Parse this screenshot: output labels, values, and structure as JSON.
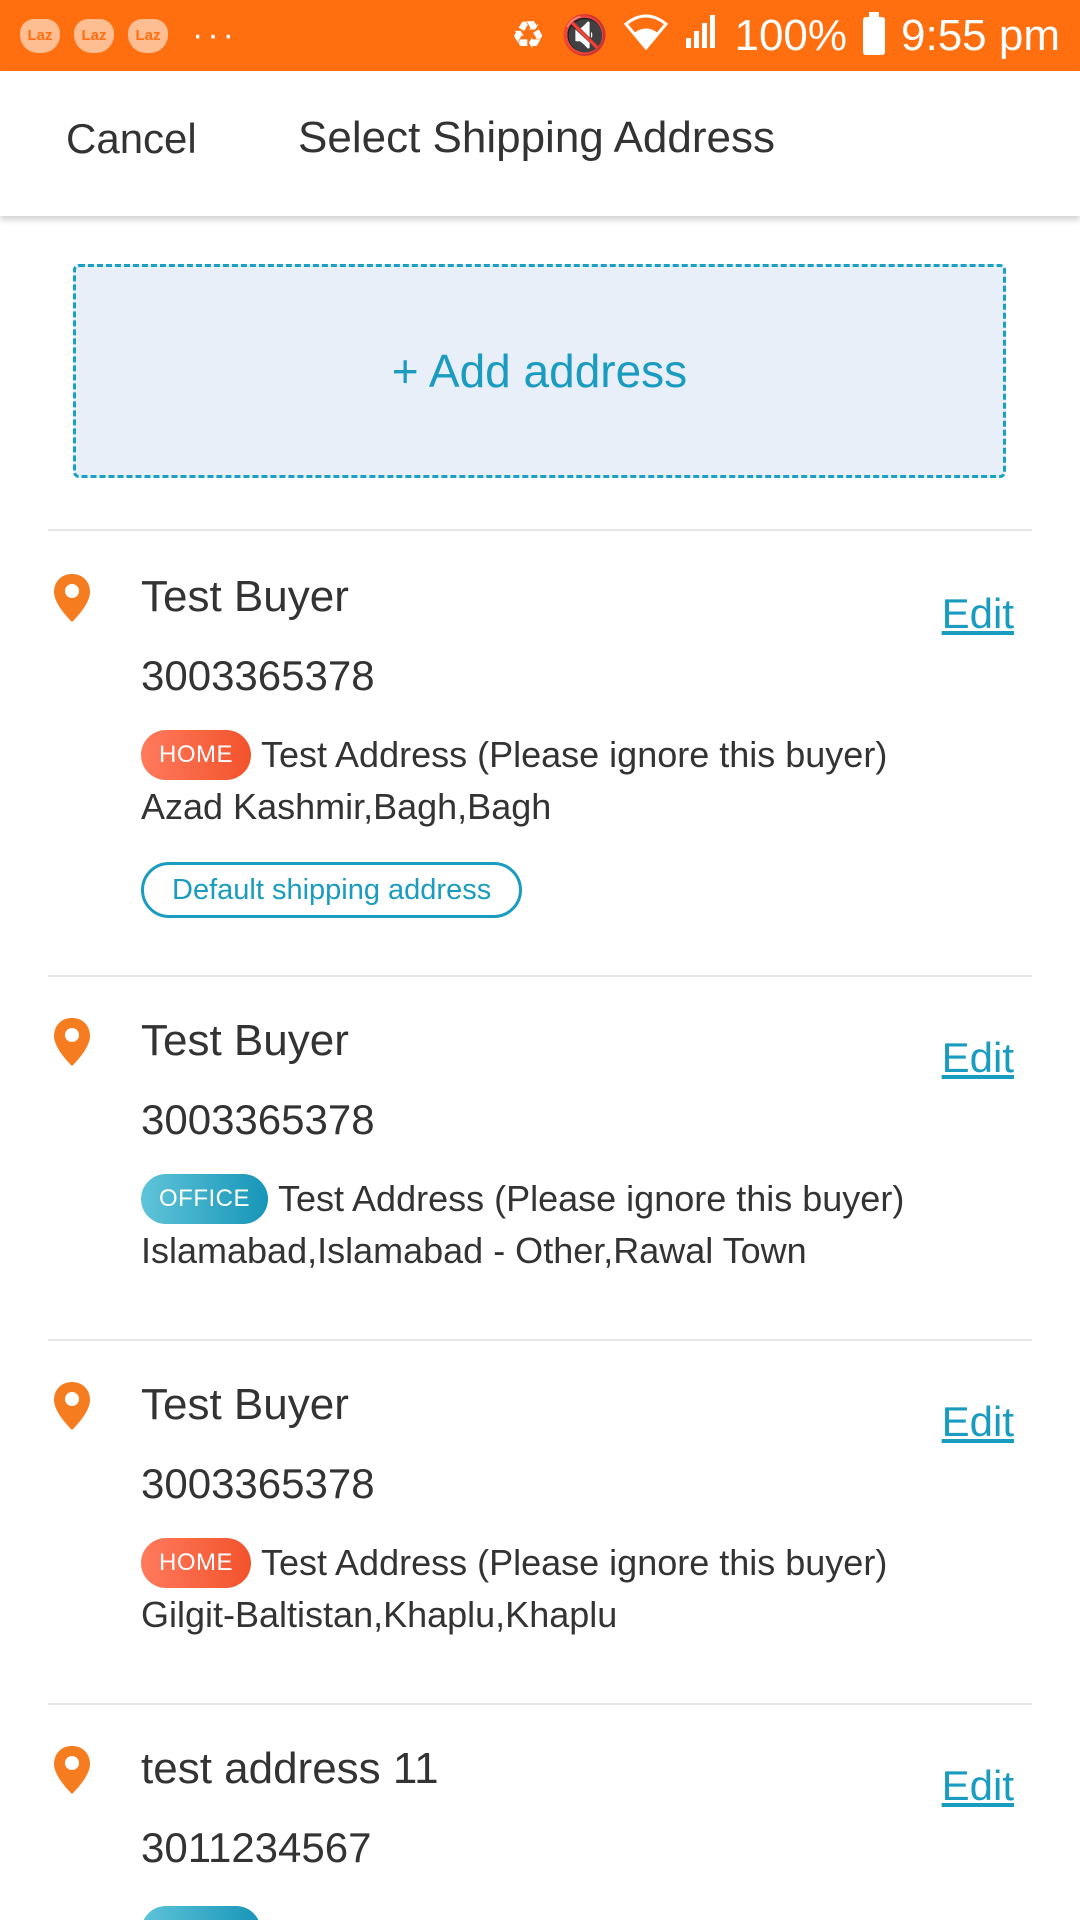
{
  "status_bar": {
    "app_icons": [
      "Laz",
      "Laz",
      "Laz"
    ],
    "more": "···",
    "battery_percent": "100%",
    "time": "9:55 pm",
    "background_color": "#ff6f0f"
  },
  "header": {
    "cancel_label": "Cancel",
    "title": "Select Shipping Address"
  },
  "add_address": {
    "label": "+ Add address"
  },
  "addresses": [
    {
      "name": "Test Buyer",
      "phone": "3003365378",
      "tag": "HOME",
      "line1": "Test Address (Please ignore this buyer)",
      "line2": "Azad Kashmir,Bagh,Bagh",
      "default_label": "Default shipping address",
      "edit_label": "Edit"
    },
    {
      "name": "Test Buyer",
      "phone": "3003365378",
      "tag": "OFFICE",
      "line1": "Test Address (Please ignore this buyer)",
      "line2": "Islamabad,Islamabad - Other,Rawal Town",
      "edit_label": "Edit"
    },
    {
      "name": "Test Buyer",
      "phone": "3003365378",
      "tag": "HOME",
      "line1": "Test Address (Please ignore this buyer)",
      "line2": "Gilgit-Baltistan,Khaplu,Khaplu",
      "edit_label": "Edit"
    },
    {
      "name": "test address 11",
      "phone": "3011234567",
      "edit_label": "Edit"
    }
  ],
  "colors": {
    "accent": "#1a9bc0",
    "pin": "#f57c1f",
    "home_tag": "#f2532c",
    "office_tag": "#1795b8"
  }
}
